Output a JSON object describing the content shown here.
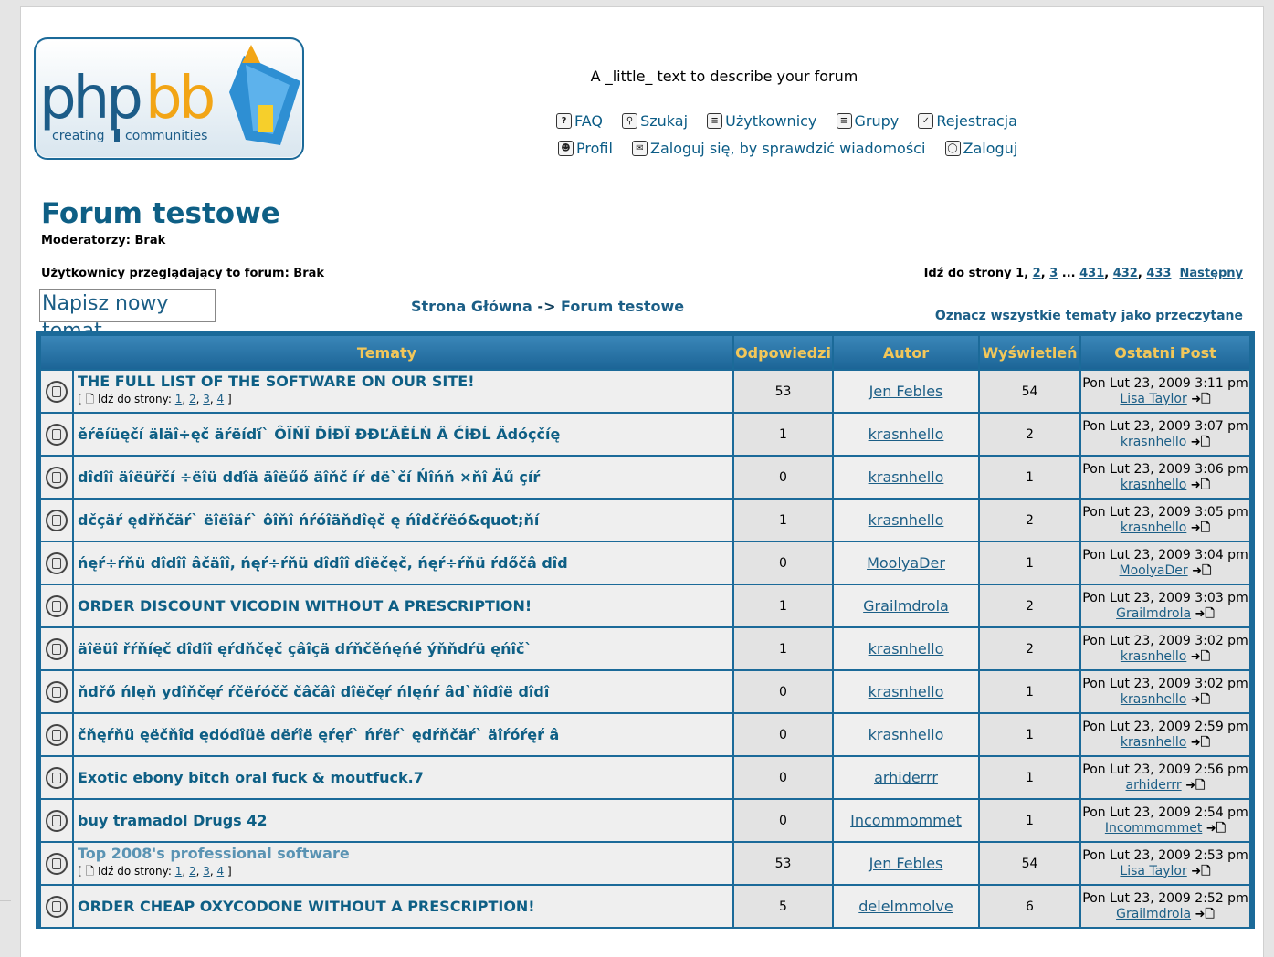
{
  "header": {
    "description": "A _little_ text to describe your forum",
    "nav_row1": [
      "FAQ",
      "Szukaj",
      "Użytkownicy",
      "Grupy",
      "Rejestracja"
    ],
    "nav_row2": [
      "Profil",
      "Zaloguj się, by sprawdzić wiadomości",
      "Zaloguj"
    ],
    "logo": {
      "text_php": "php",
      "text_bb": "bb",
      "tagline_1": "creating",
      "tagline_2": "communities"
    }
  },
  "forum": {
    "title": "Forum testowe",
    "moderators": "Moderatorzy: Brak",
    "viewers": "Użytkownicy przeglądający to forum: Brak",
    "pagination_prefix": "Idź do strony",
    "pagination_current": "1",
    "pagination_pages": [
      "2",
      "3",
      "431",
      "432",
      "433"
    ],
    "pagination_next": "Następny",
    "new_topic": "Napisz nowy temat",
    "breadcrumb_home": "Strona Główna",
    "breadcrumb_sep": "->",
    "breadcrumb_forum": "Forum testowe",
    "mark_read": "Oznacz wszystkie tematy jako przeczytane"
  },
  "table": {
    "headers": [
      "Tematy",
      "Odpowiedzi",
      "Autor",
      "Wyświetleń",
      "Ostatni Post"
    ],
    "goto_label": "Idź do strony",
    "rows": [
      {
        "title": "THE FULL LIST OF THE SOFTWARE ON OUR SITE!",
        "pages": [
          "1",
          "2",
          "3",
          "4"
        ],
        "replies": "53",
        "author": "Jen Febles",
        "views": "54",
        "last_date": "Pon Lut 23, 2009 3:11 pm",
        "last_user": "Lisa Taylor"
      },
      {
        "title": "ěŕëíüęčí äläî÷ęč äŕëíďí` ÔÏŃÎ ĎÍĐÎ ĐĐĽÄĚĹŃ Â ĆÍĐĹ Ädóçčíę",
        "replies": "1",
        "author": "krasnhello",
        "views": "2",
        "last_date": "Pon Lut 23, 2009 3:07 pm",
        "last_user": "krasnhello"
      },
      {
        "title": "dîdîî äîëüřčí ÷ëîü dďîä äîëűő äîňč íŕ dë`čí Ńîńň ×ňî Äű çíŕ",
        "replies": "0",
        "author": "krasnhello",
        "views": "1",
        "last_date": "Pon Lut 23, 2009 3:06 pm",
        "last_user": "krasnhello"
      },
      {
        "title": "dčçäŕ ędřňčäŕ` ëîëîäŕ` ôîňî ńŕóîäňdîęč ę ńîdčŕëó&quot;ňí",
        "replies": "1",
        "author": "krasnhello",
        "views": "2",
        "last_date": "Pon Lut 23, 2009 3:05 pm",
        "last_user": "krasnhello"
      },
      {
        "title": "ńęŕ÷ŕňü dîdîî âčäîî, ńęŕ÷ŕňü dîdîî dîëčęč, ńęŕ÷ŕňü ŕdőčâ dîd",
        "replies": "0",
        "author": "MoolyaDer",
        "views": "1",
        "last_date": "Pon Lut 23, 2009 3:04 pm",
        "last_user": "MoolyaDer"
      },
      {
        "title": "ORDER DISCOUNT VICODIN WITHOUT A PRESCRIPTION!",
        "replies": "1",
        "author": "Grailmdrola",
        "views": "2",
        "last_date": "Pon Lut 23, 2009 3:03 pm",
        "last_user": "Grailmdrola"
      },
      {
        "title": "äîëüî řŕňíęč dîdîî ęŕdňčęč çâîçä dŕňčěńęńé ýňňdŕü ęńîč`",
        "replies": "1",
        "author": "krasnhello",
        "views": "2",
        "last_date": "Pon Lut 23, 2009 3:02 pm",
        "last_user": "krasnhello"
      },
      {
        "title": "ňdřő ńlęň ydîňčęŕ ŕčëŕóčč čâčâî dîëčęŕ ńlęńŕ âd`ňîdîë dîdî",
        "replies": "0",
        "author": "krasnhello",
        "views": "1",
        "last_date": "Pon Lut 23, 2009 3:02 pm",
        "last_user": "krasnhello"
      },
      {
        "title": "čňęŕňü ęëčňîd ędóďîüë dëŕîë ęŕęŕ` ńŕëŕ` ędŕňčäŕ` äîŕóŕęŕ â",
        "replies": "0",
        "author": "krasnhello",
        "views": "1",
        "last_date": "Pon Lut 23, 2009 2:59 pm",
        "last_user": "krasnhello"
      },
      {
        "title": "Exotic ebony bitch oral fuck & moutfuck.7",
        "replies": "0",
        "author": "arhiderrr",
        "views": "1",
        "last_date": "Pon Lut 23, 2009 2:56 pm",
        "last_user": "arhiderrr"
      },
      {
        "title": "buy tramadol Drugs 42",
        "replies": "0",
        "author": "Incommommet",
        "views": "1",
        "last_date": "Pon Lut 23, 2009 2:54 pm",
        "last_user": "Incommommet"
      },
      {
        "title": "Top 2008's professional software",
        "light": true,
        "pages": [
          "1",
          "2",
          "3",
          "4"
        ],
        "replies": "53",
        "author": "Jen Febles",
        "views": "54",
        "last_date": "Pon Lut 23, 2009 2:53 pm",
        "last_user": "Lisa Taylor"
      },
      {
        "title": "ORDER CHEAP OXYCODONE WITHOUT A PRESCRIPTION!",
        "replies": "5",
        "author": "delelmmolve",
        "views": "6",
        "last_date": "Pon Lut 23, 2009 2:52 pm",
        "last_user": "Grailmdrola"
      }
    ]
  },
  "colors": {
    "accent": "#1b6a99",
    "title": "#0e5f85",
    "header_text": "#f2c75a",
    "link": "#1b5e86"
  }
}
